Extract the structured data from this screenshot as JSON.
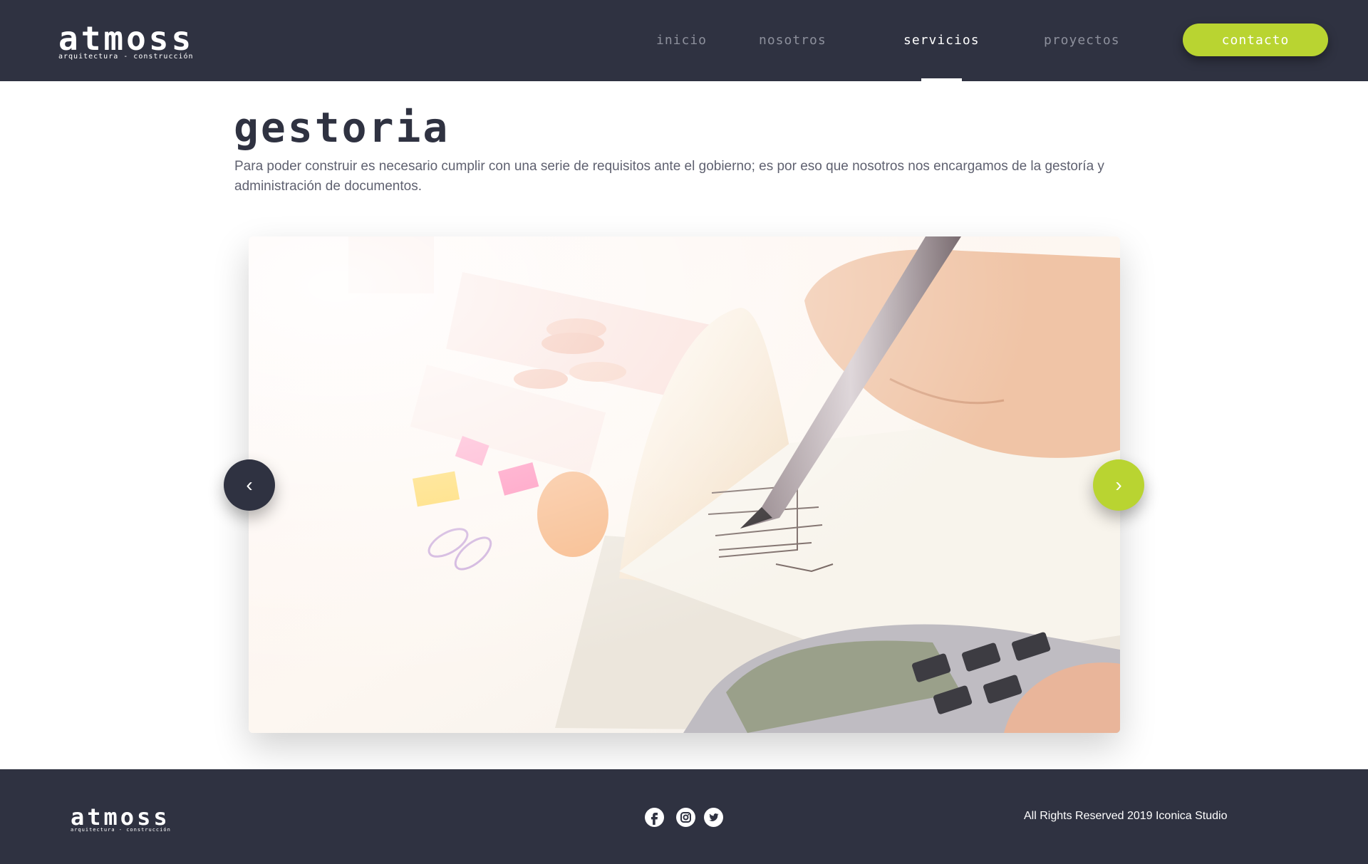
{
  "brand": {
    "name": "atmoss",
    "tagline": "arquitectura - construcción"
  },
  "nav": {
    "items": [
      {
        "label": "inicio",
        "active": false
      },
      {
        "label": "nosotros",
        "active": false
      },
      {
        "label": "servicios",
        "active": true
      },
      {
        "label": "proyectos",
        "active": false
      }
    ],
    "contact_label": "contacto"
  },
  "colors": {
    "dark": "#2f3241",
    "accent": "#b9d431",
    "text_muted": "#5f6170",
    "nav_inactive": "#8d909c"
  },
  "section": {
    "title": "gestoria",
    "description": "Para poder construir es necesario cumplir con una serie de requisitos ante el gobierno; es por eso que nosotros nos encargamos de la gestoría y administración de documentos."
  },
  "carousel": {
    "prev_icon": "chevron-left-icon",
    "next_icon": "chevron-right-icon",
    "prev_glyph": "‹",
    "next_glyph": "›"
  },
  "footer": {
    "social": [
      {
        "name": "facebook-icon"
      },
      {
        "name": "instagram-icon"
      },
      {
        "name": "twitter-icon"
      }
    ],
    "copyright": "All Rights Reserved 2019 Iconica Studio"
  }
}
